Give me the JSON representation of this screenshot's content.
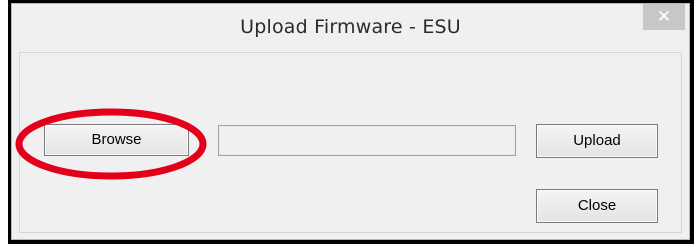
{
  "window": {
    "title": "Upload Firmware - ESU",
    "close_glyph": "✕"
  },
  "controls": {
    "browse_label": "Browse",
    "file_path_value": "",
    "upload_label": "Upload",
    "close_label": "Close"
  },
  "annotation": {
    "highlight_color": "#e3001b",
    "highlight_target": "browse-button"
  }
}
